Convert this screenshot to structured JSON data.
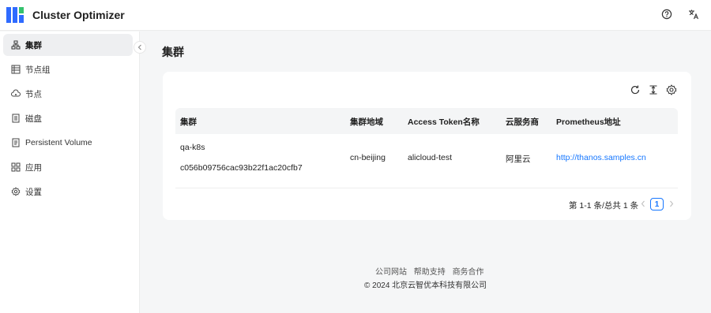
{
  "app": {
    "title": "Cluster Optimizer"
  },
  "header": {
    "help_icon": "question-circle-icon",
    "lang_icon": "translate-icon"
  },
  "sidebar": {
    "items": [
      {
        "label": "集群",
        "icon": "cluster-icon",
        "active": true
      },
      {
        "label": "节点组",
        "icon": "node-group-icon",
        "active": false
      },
      {
        "label": "节点",
        "icon": "node-icon",
        "active": false
      },
      {
        "label": "磁盘",
        "icon": "disk-icon",
        "active": false
      },
      {
        "label": "Persistent Volume",
        "icon": "volume-icon",
        "active": false
      },
      {
        "label": "应用",
        "icon": "apps-icon",
        "active": false
      },
      {
        "label": "设置",
        "icon": "settings-icon",
        "active": false
      }
    ]
  },
  "main": {
    "title": "集群",
    "toolbar": {
      "icons": [
        "reload-icon",
        "column-height-icon",
        "settings-icon"
      ]
    },
    "table": {
      "columns": [
        "集群",
        "集群地域",
        "Access Token名称",
        "云服务商",
        "Prometheus地址"
      ],
      "rows": [
        {
          "name": "qa-k8s",
          "id": "c056b09756cac93b22f1ac20cfb7",
          "region": "cn-beijing",
          "token": "alicloud-test",
          "provider": "阿里云",
          "prometheus": "http://thanos.samples.cn"
        }
      ]
    },
    "pagination": {
      "summary": "第 1-1 条/总共 1 条",
      "current_page": "1"
    }
  },
  "footer": {
    "links": [
      "公司网站",
      "帮助支持",
      "商务合作"
    ],
    "copyright": "© 2024 北京云智优本科技有限公司"
  },
  "colors": {
    "accent": "#1677ff",
    "logo_blue": "#2f6bff",
    "logo_green": "#35c26e"
  }
}
